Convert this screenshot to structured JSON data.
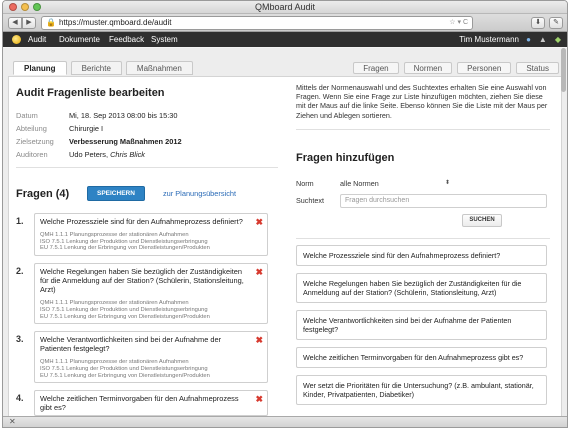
{
  "window": {
    "title": "QMboard  Audit"
  },
  "browser": {
    "url": "https://muster.qmboard.de/audit",
    "url_extra": "☆ ▾ C"
  },
  "appbar": {
    "menu": [
      "Audit",
      "Dokumente",
      "Feedback",
      "System"
    ],
    "user": "Tim Mustermann"
  },
  "tabs_left": [
    "Planung",
    "Berichte",
    "Maßnahmen"
  ],
  "tabs_right": [
    "Fragen",
    "Normen",
    "Personen",
    "Status"
  ],
  "audit": {
    "heading": "Audit Fragenliste bearbeiten",
    "fields": [
      {
        "label": "Datum",
        "value": "Mi, 18. Sep 2013  08:00 bis 15:30"
      },
      {
        "label": "Abteilung",
        "value": "Chirurgie I"
      },
      {
        "label": "Zielsetzung",
        "value": "Verbesserung Maßnahmen 2012"
      },
      {
        "label": "Auditoren",
        "value": "Udo Peters, ",
        "value_italic": "Chris Blick"
      }
    ]
  },
  "fragen": {
    "title": "Fragen (4)",
    "save_label": "SPEICHERN",
    "plan_link": "zur Planungsübersicht",
    "items": [
      {
        "num": "1.",
        "text": "Welche Prozessziele sind für den Aufnahmeprozess definiert?",
        "norms": [
          "QMH 1.1.1 Planungsprozesse der stationären Aufnahmen",
          "ISO 7.5.1 Lenkung der Produktion und Dienstleistungserbringung",
          "EU 7.5.1 Lenkung der Erbringung von Dienstleistungen/Produkten"
        ]
      },
      {
        "num": "2.",
        "text": "Welche Regelungen haben Sie bezüglich der Zuständigkeiten für die Anmeldung auf der Station? (Schülerin, Stationsleitung, Arzt)",
        "norms": [
          "QMH 1.1.1 Planungsprozesse der stationären Aufnahmen",
          "ISO 7.5.1 Lenkung der Produktion und Dienstleistungserbringung",
          "EU 7.5.1 Lenkung der Erbringung von Dienstleistungen/Produkten"
        ]
      },
      {
        "num": "3.",
        "text": "Welche Verantwortlichkeiten sind bei der Aufnahme der Patienten festgelegt?",
        "norms": [
          "QMH 1.1.1 Planungsprozesse der stationären Aufnahmen",
          "ISO 7.5.1 Lenkung der Produktion und Dienstleistungserbringung",
          "EU 7.5.1 Lenkung der Erbringung von Dienstleistungen/Produkten"
        ]
      },
      {
        "num": "4.",
        "text": "Welche zeitlichen Terminvorgaben für den Aufnahmeprozess gibt es?",
        "norms": []
      }
    ]
  },
  "right": {
    "description": "Mittels der Normenauswahl und des Suchtextes erhalten Sie eine Auswahl von Fragen. Wenn Sie eine Frage zur Liste hinzufügen möchten, ziehen Sie diese mit der Maus auf die linke Seite. Ebenso können Sie die Liste mit der Maus per Ziehen und Ablegen sortieren.",
    "heading": "Fragen hinzufügen",
    "norm_label": "Norm",
    "norm_value": "alle Normen",
    "search_label": "Suchtext",
    "search_placeholder": "Fragen durchsuchen",
    "search_button": "SUCHEN",
    "results": [
      "Welche Prozessziele sind für den Aufnahmeprozess definiert?",
      "Welche Regelungen haben Sie bezüglich der Zuständigkeiten für die Anmeldung auf der Station? (Schülerin, Stationsleitung, Arzt)",
      "Welche Verantwortlichkeiten sind bei der Aufnahme der Patienten festgelegt?",
      "Welche zeitlichen Terminvorgaben für den Aufnahmeprozess gibt es?",
      "Wer setzt die Prioritäten für die Untersuchung? (z.B. ambulant, stationär, Kinder, Privatpatienten, Diabetiker)"
    ]
  },
  "icons": {
    "delete_color": "#d73a2f",
    "accent": "#2e83c4"
  }
}
